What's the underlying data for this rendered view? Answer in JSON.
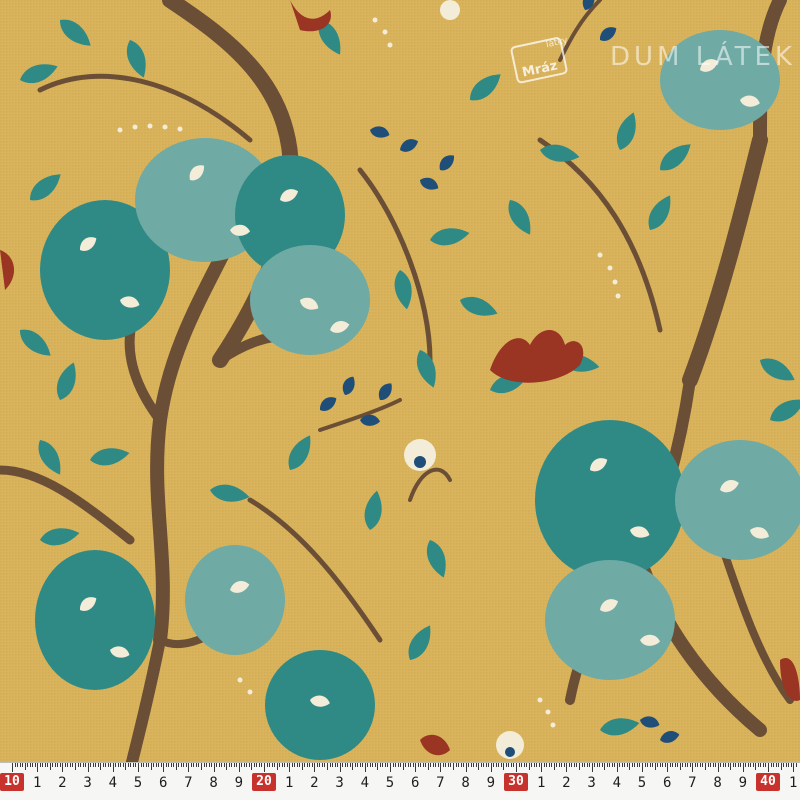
{
  "image": {
    "subject": "yellow fabric with teal trees",
    "background_color": "#d9b45c",
    "palette": {
      "mustard": "#d9b45c",
      "teal": "#2f8a86",
      "teal_light": "#6faaa4",
      "teal_dark": "#1f6a66",
      "navy": "#1f4e78",
      "cream": "#f3ecd8",
      "brown": "#6b4e36",
      "rust": "#9a3524"
    }
  },
  "watermark": {
    "badge_top": "látky",
    "badge_bottom": "Mráz",
    "text": "DUM LÁTEK"
  },
  "ruler": {
    "labels": [
      "10",
      "1",
      "2",
      "3",
      "4",
      "5",
      "6",
      "7",
      "8",
      "9",
      "20",
      "1",
      "2",
      "3",
      "4",
      "5",
      "6",
      "7",
      "8",
      "9",
      "30",
      "1",
      "2",
      "3",
      "4",
      "5",
      "6",
      "7",
      "8",
      "9",
      "40",
      "1"
    ],
    "highlighted": [
      "10",
      "20",
      "30",
      "40"
    ],
    "unit": "cm"
  }
}
